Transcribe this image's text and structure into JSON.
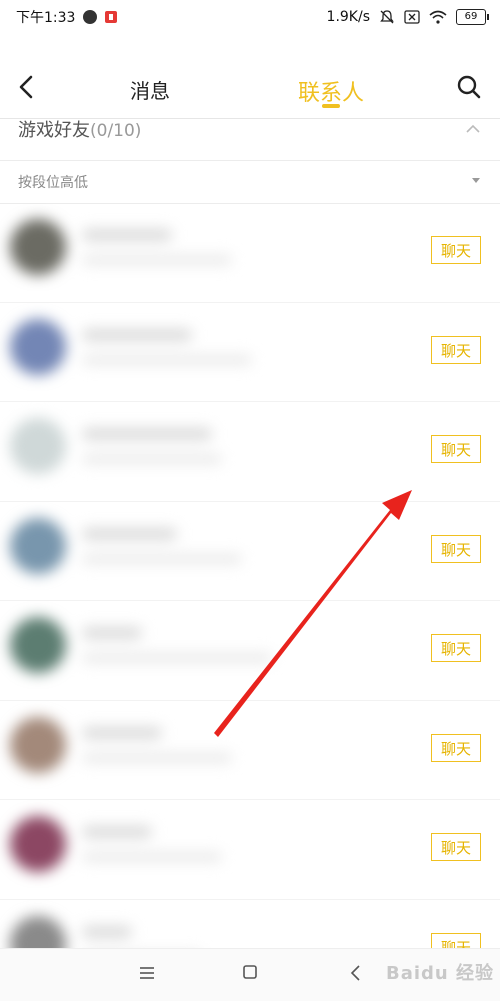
{
  "status_bar": {
    "time": "下午1:33",
    "network_speed": "1.9K/s",
    "battery": "69"
  },
  "nav": {
    "tab_messages": "消息",
    "tab_contacts": "联系人",
    "active_tab": "联系人",
    "accent_color": "#f0c020"
  },
  "group": {
    "title": "游戏好友",
    "count": "(0/10)"
  },
  "sort": {
    "label": "按段位高低"
  },
  "friends": [
    {
      "chat_label": "聊天",
      "avatar_color": "#6b6b63"
    },
    {
      "chat_label": "聊天",
      "avatar_color": "#7386b5"
    },
    {
      "chat_label": "聊天",
      "avatar_color": "#cfd8d8"
    },
    {
      "chat_label": "聊天",
      "avatar_color": "#7896ad"
    },
    {
      "chat_label": "聊天",
      "avatar_color": "#5c7d71"
    },
    {
      "chat_label": "聊天",
      "avatar_color": "#a3897a"
    },
    {
      "chat_label": "聊天",
      "avatar_color": "#8c4763"
    },
    {
      "chat_label": "聊天",
      "avatar_color": "#8a8a8a"
    }
  ],
  "watermark": "Baidu 经验",
  "icons": [
    "back-icon",
    "search-icon",
    "collapse-icon",
    "menu-icon",
    "home-icon",
    "back-nav-icon"
  ]
}
